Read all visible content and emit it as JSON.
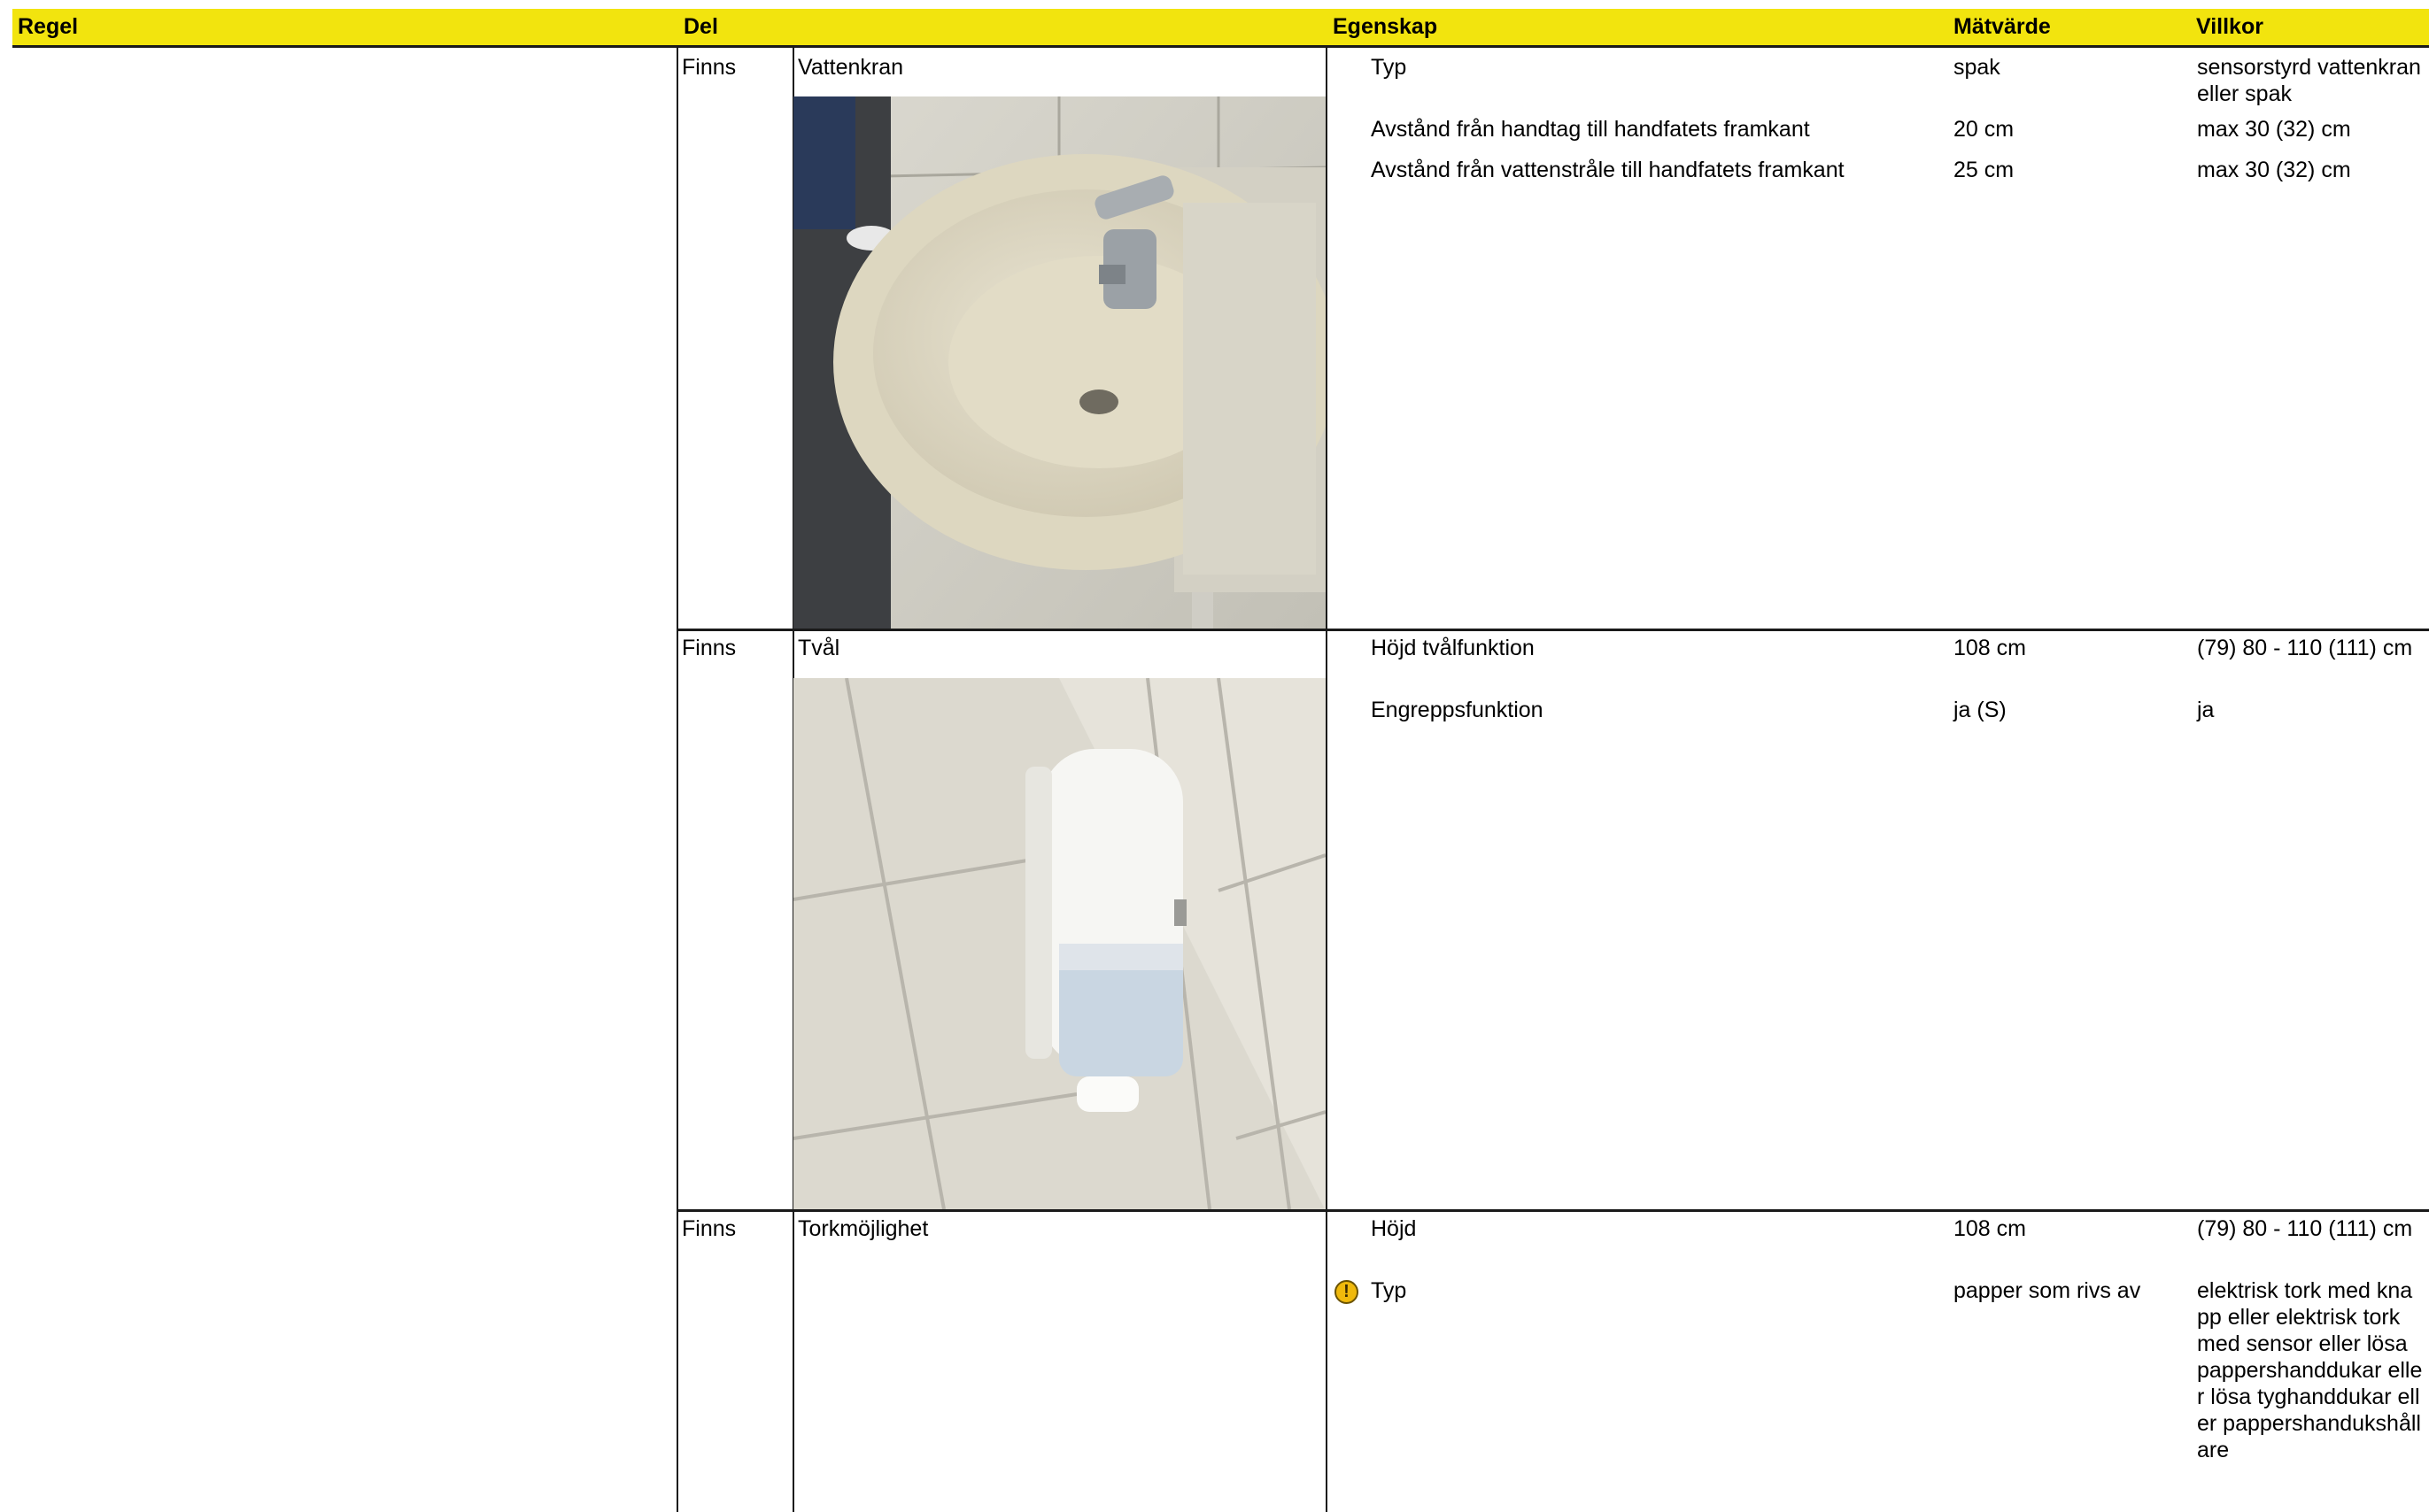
{
  "header": {
    "regel": "Regel",
    "del": "Del",
    "egenskap": "Egenskap",
    "matvarde": "Mätvärde",
    "villkor": "Villkor"
  },
  "rows": [
    {
      "status": "Finns",
      "part": "Vattenkran",
      "photo_icon": "faucet-sink-photo",
      "properties": [
        {
          "name": "Typ",
          "value": "spak",
          "condition": "sensorstyrd vattenkran eller spak"
        },
        {
          "name": "Avstånd från handtag till handfatets framkant",
          "value": "20 cm",
          "condition": "max 30 (32) cm"
        },
        {
          "name": "Avstånd från vattenstråle till handfatets framkant",
          "value": "25 cm",
          "condition": "max 30 (32) cm"
        }
      ]
    },
    {
      "status": "Finns",
      "part": "Tvål",
      "photo_icon": "soap-dispenser-photo",
      "properties": [
        {
          "name": "Höjd tvålfunktion",
          "value": "108 cm",
          "condition": "(79) 80 - 110 (111) cm"
        },
        {
          "name": "Engreppsfunktion",
          "value": "ja (S)",
          "condition": "ja"
        }
      ]
    },
    {
      "status": "Finns",
      "part": "Torkmöjlighet",
      "properties": [
        {
          "name": "Höjd",
          "value": "108 cm",
          "condition": "(79) 80 - 110 (111) cm"
        },
        {
          "name": "Typ",
          "value": "papper som rivs av",
          "condition": "elektrisk tork med knapp eller elektrisk tork med sensor eller lösa pappershanddukar eller lösa tyghanddukar eller pappershandukshållare",
          "warning_icon": "warning-icon"
        }
      ]
    }
  ],
  "colors": {
    "header_bg": "#f2e40e",
    "warning": "#f0b90c",
    "lines": "#1a1a1a"
  }
}
